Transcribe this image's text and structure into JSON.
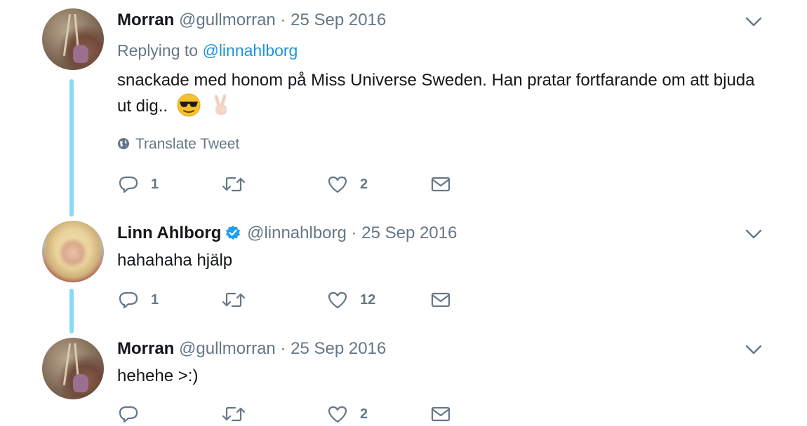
{
  "tweets": [
    {
      "name": "Morran",
      "handle": "@gullmorran",
      "separator": "·",
      "date": "25 Sep 2016",
      "replying_prefix": "Replying to",
      "replying_to": "@linnahlborg",
      "text": "snackade med honom på Miss Universe Sweden. Han pratar fortfarande om att bjuda ut dig..",
      "emojis": [
        "sunglasses-emoji",
        "victory-hand-emoji"
      ],
      "translate_label": "Translate Tweet",
      "replies": "1",
      "retweets": "",
      "likes": "2"
    },
    {
      "name": "Linn Ahlborg",
      "verified": true,
      "handle": "@linnahlborg",
      "separator": "·",
      "date": "25 Sep 2016",
      "text": "hahahaha hjälp",
      "replies": "1",
      "retweets": "",
      "likes": "12"
    },
    {
      "name": "Morran",
      "handle": "@gullmorran",
      "separator": "·",
      "date": "25 Sep 2016",
      "text": "hehehe >:)",
      "replies": "",
      "retweets": "",
      "likes": "2"
    }
  ],
  "colors": {
    "link": "#1b95e0",
    "muted": "#657786",
    "thread_line": "#86dcf2",
    "verified": "#1da1f2"
  },
  "icons": [
    "reply-icon",
    "retweet-icon",
    "like-icon",
    "direct-message-icon",
    "chevron-down-icon",
    "globe-icon",
    "verified-icon"
  ]
}
